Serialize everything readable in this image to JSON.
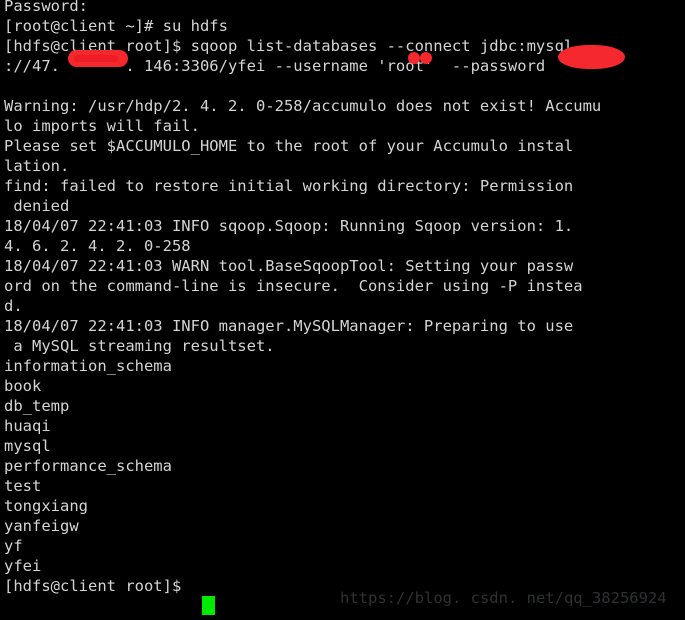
{
  "terminal": {
    "title": "shell-session",
    "colors": {
      "background": "#000000",
      "foreground": "#d4d4d4",
      "cursor": "#00ea00",
      "redaction": "#f5282d",
      "watermark": "#2f3133"
    },
    "lines": [
      "Password:",
      "[root@client ~]# su hdfs",
      "[hdfs@client root]$ sqoop list-databases --connect jdbc:mysql",
      "://47.       . 146:3306/yfei --username 'root'  --password",
      "",
      "Warning: /usr/hdp/2. 4. 2. 0-258/accumulo does not exist! Accumu",
      "lo imports will fail.",
      "Please set $ACCUMULO_HOME to the root of your Accumulo instal",
      "lation.",
      "find: failed to restore initial working directory: Permission",
      " denied",
      "18/04/07 22:41:03 INFO sqoop.Sqoop: Running Sqoop version: 1.",
      "4. 6. 2. 4. 2. 0-258",
      "18/04/07 22:41:03 WARN tool.BaseSqoopTool: Setting your passw",
      "ord on the command-line is insecure.  Consider using -P instea",
      "d.",
      "18/04/07 22:41:03 INFO manager.MySQLManager: Preparing to use",
      " a MySQL streaming resultset.",
      "information_schema",
      "book",
      "db_temp",
      "huaqi",
      "mysql",
      "performance_schema",
      "test",
      "tongxiang",
      "yanfeigw",
      "yf",
      "yfei",
      "[hdfs@client root]$ "
    ],
    "databases": [
      "information_schema",
      "book",
      "db_temp",
      "huaqi",
      "mysql",
      "performance_schema",
      "test",
      "tongxiang",
      "yanfeigw",
      "yf",
      "yfei"
    ],
    "prompts": {
      "root_prompt": "[root@client ~]#",
      "hdfs_prompt": "[hdfs@client root]$"
    },
    "commands": {
      "su": "su hdfs",
      "sqoop": "sqoop list-databases --connect jdbc:mysql://47.xxx.146:3306/yfei --username 'root' --password xxxxx"
    },
    "redactions": {
      "ip_octets": "redacted-ip-segment",
      "username_chars": "redacted-username-chars",
      "password": "redacted-password"
    },
    "cursor": "block-cursor"
  },
  "watermark": {
    "text": "https://blog. csdn. net/qq_38256924"
  }
}
